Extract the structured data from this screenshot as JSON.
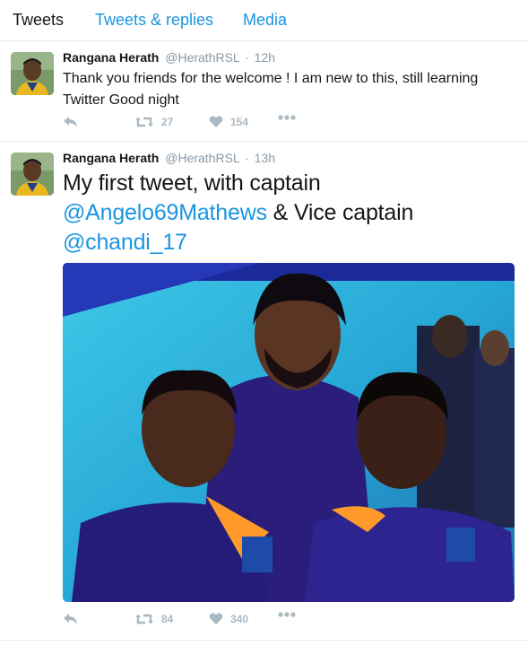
{
  "tabs": [
    "Tweets",
    "Tweets & replies",
    "Media"
  ],
  "tweets": [
    {
      "name": "Rangana Herath",
      "handle": "@HerathRSL",
      "time": "12h",
      "text": "Thank you friends for the welcome ! I am new to this, still learning Twitter Good night",
      "retweets": "27",
      "likes": "154"
    },
    {
      "name": "Rangana Herath",
      "handle": "@HerathRSL",
      "time": "13h",
      "text_part1": "My first tweet, with captain ",
      "mention1": "@Angelo69Mathews",
      "text_part2": " & Vice captain ",
      "mention2": "@chandi_17",
      "retweets": "84",
      "likes": "340"
    }
  ],
  "colors": {
    "link": "#1b95e0",
    "text": "#14171a",
    "muted": "#8899a6",
    "action": "#aab8c2",
    "border": "#e6ecf0"
  },
  "icons": [
    "reply-icon",
    "retweet-icon",
    "like-icon",
    "more-icon"
  ]
}
